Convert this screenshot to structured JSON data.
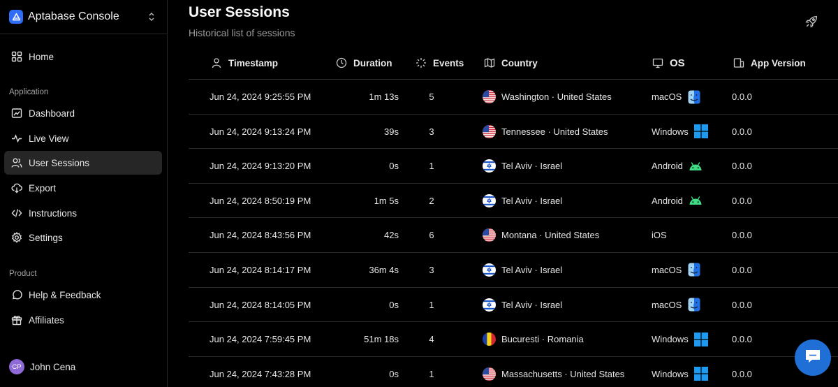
{
  "app": {
    "name": "Aptabase Console"
  },
  "sidebar": {
    "home": "Home",
    "section_application": "Application",
    "items": [
      {
        "label": "Dashboard"
      },
      {
        "label": "Live View"
      },
      {
        "label": "User Sessions"
      },
      {
        "label": "Export"
      },
      {
        "label": "Instructions"
      },
      {
        "label": "Settings"
      }
    ],
    "section_product": "Product",
    "product_items": [
      {
        "label": "Help & Feedback"
      },
      {
        "label": "Affiliates"
      }
    ],
    "user": {
      "initials": "CP",
      "name": "John Cena"
    }
  },
  "page": {
    "title": "User Sessions",
    "subtitle": "Historical list of sessions"
  },
  "table": {
    "headers": {
      "timestamp": "Timestamp",
      "duration": "Duration",
      "events": "Events",
      "country": "Country",
      "os": "OS",
      "app_version": "App Version"
    },
    "rows": [
      {
        "timestamp": "Jun 24, 2024 9:25:55 PM",
        "duration": "1m 13s",
        "events": "5",
        "country": "Washington · United States",
        "flag": "us",
        "os": "macOS",
        "os_icon": "finder-icon",
        "version": "0.0.0"
      },
      {
        "timestamp": "Jun 24, 2024 9:13:24 PM",
        "duration": "39s",
        "events": "3",
        "country": "Tennessee · United States",
        "flag": "us",
        "os": "Windows",
        "os_icon": "windows-icon",
        "version": "0.0.0"
      },
      {
        "timestamp": "Jun 24, 2024 9:13:20 PM",
        "duration": "0s",
        "events": "1",
        "country": "Tel Aviv · Israel",
        "flag": "il",
        "os": "Android",
        "os_icon": "android-icon",
        "version": "0.0.0"
      },
      {
        "timestamp": "Jun 24, 2024 8:50:19 PM",
        "duration": "1m 5s",
        "events": "2",
        "country": "Tel Aviv · Israel",
        "flag": "il",
        "os": "Android",
        "os_icon": "android-icon",
        "version": "0.0.0"
      },
      {
        "timestamp": "Jun 24, 2024 8:43:56 PM",
        "duration": "42s",
        "events": "6",
        "country": "Montana · United States",
        "flag": "us",
        "os": "iOS",
        "os_icon": "",
        "version": "0.0.0"
      },
      {
        "timestamp": "Jun 24, 2024 8:14:17 PM",
        "duration": "36m 4s",
        "events": "3",
        "country": "Tel Aviv · Israel",
        "flag": "il",
        "os": "macOS",
        "os_icon": "finder-icon",
        "version": "0.0.0"
      },
      {
        "timestamp": "Jun 24, 2024 8:14:05 PM",
        "duration": "0s",
        "events": "1",
        "country": "Tel Aviv · Israel",
        "flag": "il",
        "os": "macOS",
        "os_icon": "finder-icon",
        "version": "0.0.0"
      },
      {
        "timestamp": "Jun 24, 2024 7:59:45 PM",
        "duration": "51m 18s",
        "events": "4",
        "country": "Bucuresti · Romania",
        "flag": "ro",
        "os": "Windows",
        "os_icon": "windows-icon",
        "version": "0.0.0"
      },
      {
        "timestamp": "Jun 24, 2024 7:43:28 PM",
        "duration": "0s",
        "events": "1",
        "country": "Massachusetts · United States",
        "flag": "us",
        "os": "Windows",
        "os_icon": "windows-icon",
        "version": "0.0.0"
      }
    ]
  },
  "colors": {
    "accent": "#2f6df6",
    "active_nav": "#262626",
    "chat_button": "#1f6fd6",
    "windows": "#1e9bf0",
    "android": "#3ddc84"
  }
}
